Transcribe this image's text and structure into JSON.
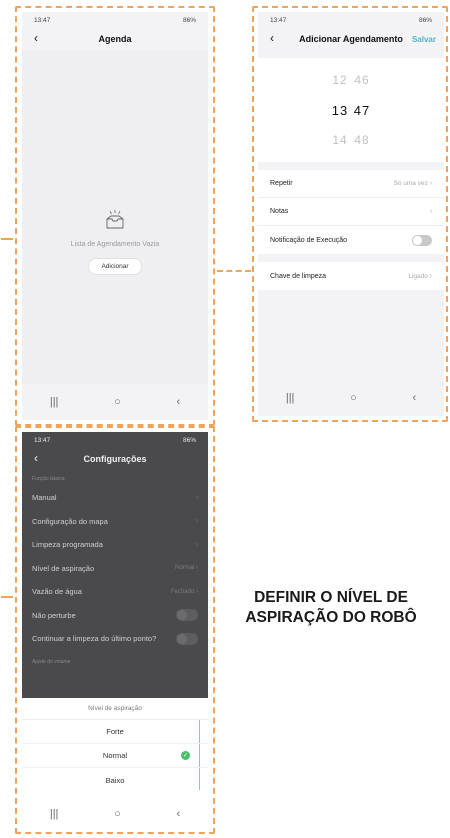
{
  "screen1": {
    "status_time": "13:47",
    "status_right": "86%",
    "title": "Agenda",
    "empty_text": "Lista de Agendamento Vazia",
    "add_button": "Adicionar"
  },
  "screen2": {
    "status_time": "13:47",
    "status_right": "86%",
    "title": "Adicionar Agendamento",
    "save": "Salvar",
    "picker": [
      {
        "h": "12",
        "m": "46"
      },
      {
        "h": "13",
        "m": "47"
      },
      {
        "h": "14",
        "m": "48"
      }
    ],
    "rows": {
      "repeat": {
        "label": "Repetir",
        "value": "Só uma vez"
      },
      "notes": {
        "label": "Notas"
      },
      "notification": {
        "label": "Notificação de Execução"
      },
      "cleaning_key": {
        "label": "Chave de limpeza",
        "value": "Ligado"
      }
    }
  },
  "screen3": {
    "status_time": "13:47",
    "status_right": "86%",
    "title": "Configurações",
    "section_header": "Função básica",
    "rows": {
      "manual": "Manual",
      "map_config": "Configuração do mapa",
      "scheduled_clean": "Limpeza programada",
      "suction_level": {
        "label": "Nível de aspiração",
        "value": "Normal"
      },
      "water_flow": {
        "label": "Vazão de água",
        "value": "Fechado"
      },
      "dnd": "Não perturbe",
      "resume": "Continuar a limpeza do último ponto?"
    },
    "footer_section": "Ajuste do volume",
    "sheet": {
      "title": "Nível de aspiração",
      "options": [
        "Forte",
        "Normal",
        "Baixo"
      ],
      "selected": "Normal"
    }
  },
  "caption": "DEFINIR O NÍVEL DE ASPIRAÇÃO DO ROBÔ",
  "colors": {
    "accent": "#4fb2c6",
    "dash": "#f0a35b",
    "check": "#4bbe6a"
  }
}
